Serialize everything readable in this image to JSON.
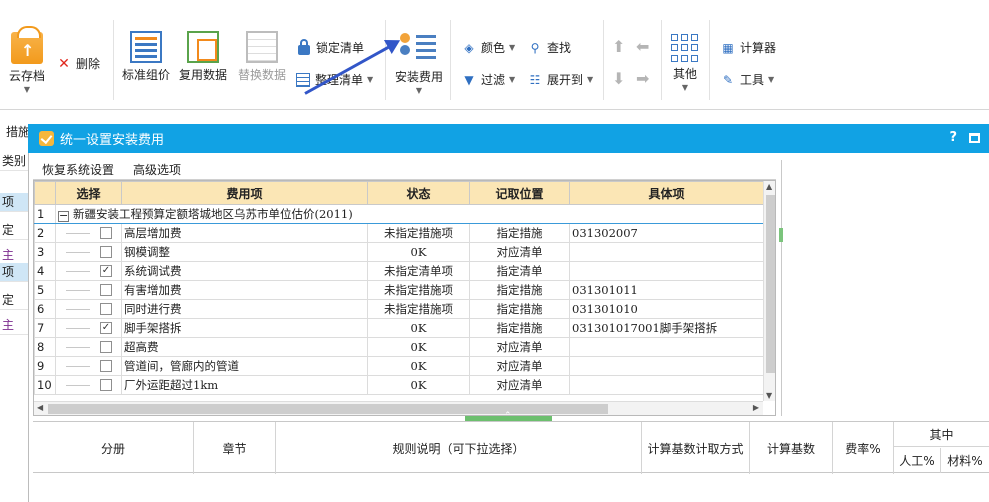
{
  "ribbon": {
    "save": "云存档",
    "delete": "删除",
    "std_price": "标准组价",
    "reuse": "复用数据",
    "replace": "替换数据",
    "lock": "锁定清单",
    "tidy": "整理清单",
    "install_fee": "安装费用",
    "color": "颜色",
    "find": "查找",
    "filter": "过滤",
    "expand": "展开到",
    "other": "其他",
    "calculator": "计算器",
    "tools": "工具"
  },
  "background": {
    "tab": "措施",
    "left_cells": [
      "类别",
      "项",
      "定",
      "主",
      "项",
      "定",
      "主"
    ]
  },
  "dialog": {
    "title": "统一设置安装费用",
    "help": "?",
    "menu": [
      "恢复系统设置",
      "高级选项"
    ],
    "columns": [
      "选择",
      "费用项",
      "状态",
      "记取位置",
      "具体项"
    ],
    "group_row": {
      "num": "1",
      "name": "新疆安装工程预算定额塔城地区乌苏市单位估价(2011)"
    },
    "rows": [
      {
        "num": "2",
        "checked": false,
        "fee": "高层增加费",
        "status": "未指定措施项",
        "position": "指定措施",
        "detail": "031302007"
      },
      {
        "num": "3",
        "checked": false,
        "fee": "钢模调整",
        "status": "0K",
        "position": "对应清单",
        "detail": ""
      },
      {
        "num": "4",
        "checked": true,
        "fee": "系统调试费",
        "status": "未指定清单项",
        "position": "指定清单",
        "detail": ""
      },
      {
        "num": "5",
        "checked": false,
        "fee": "有害增加费",
        "status": "未指定措施项",
        "position": "指定措施",
        "detail": "031301011"
      },
      {
        "num": "6",
        "checked": false,
        "fee": "同时进行费",
        "status": "未指定措施项",
        "position": "指定措施",
        "detail": "031301010"
      },
      {
        "num": "7",
        "checked": true,
        "fee": "脚手架搭拆",
        "status": "0K",
        "position": "指定措施",
        "detail": "031301017001脚手架搭拆"
      },
      {
        "num": "8",
        "checked": false,
        "fee": "超高费",
        "status": "0K",
        "position": "对应清单",
        "detail": ""
      },
      {
        "num": "9",
        "checked": false,
        "fee": "管道间，管廊内的管道",
        "status": "0K",
        "position": "对应清单",
        "detail": ""
      },
      {
        "num": "10",
        "checked": false,
        "fee": "厂外运距超过1km",
        "status": "0K",
        "position": "对应清单",
        "detail": ""
      }
    ],
    "lower_columns": {
      "volume": "分册",
      "chapter": "章节",
      "rule": "规则说明（可下拉选择）",
      "base_method": "计算基数计取方式",
      "base": "计算基数",
      "rate": "费率%",
      "of_which": "其中",
      "labor": "人工%",
      "material": "材料%"
    }
  }
}
